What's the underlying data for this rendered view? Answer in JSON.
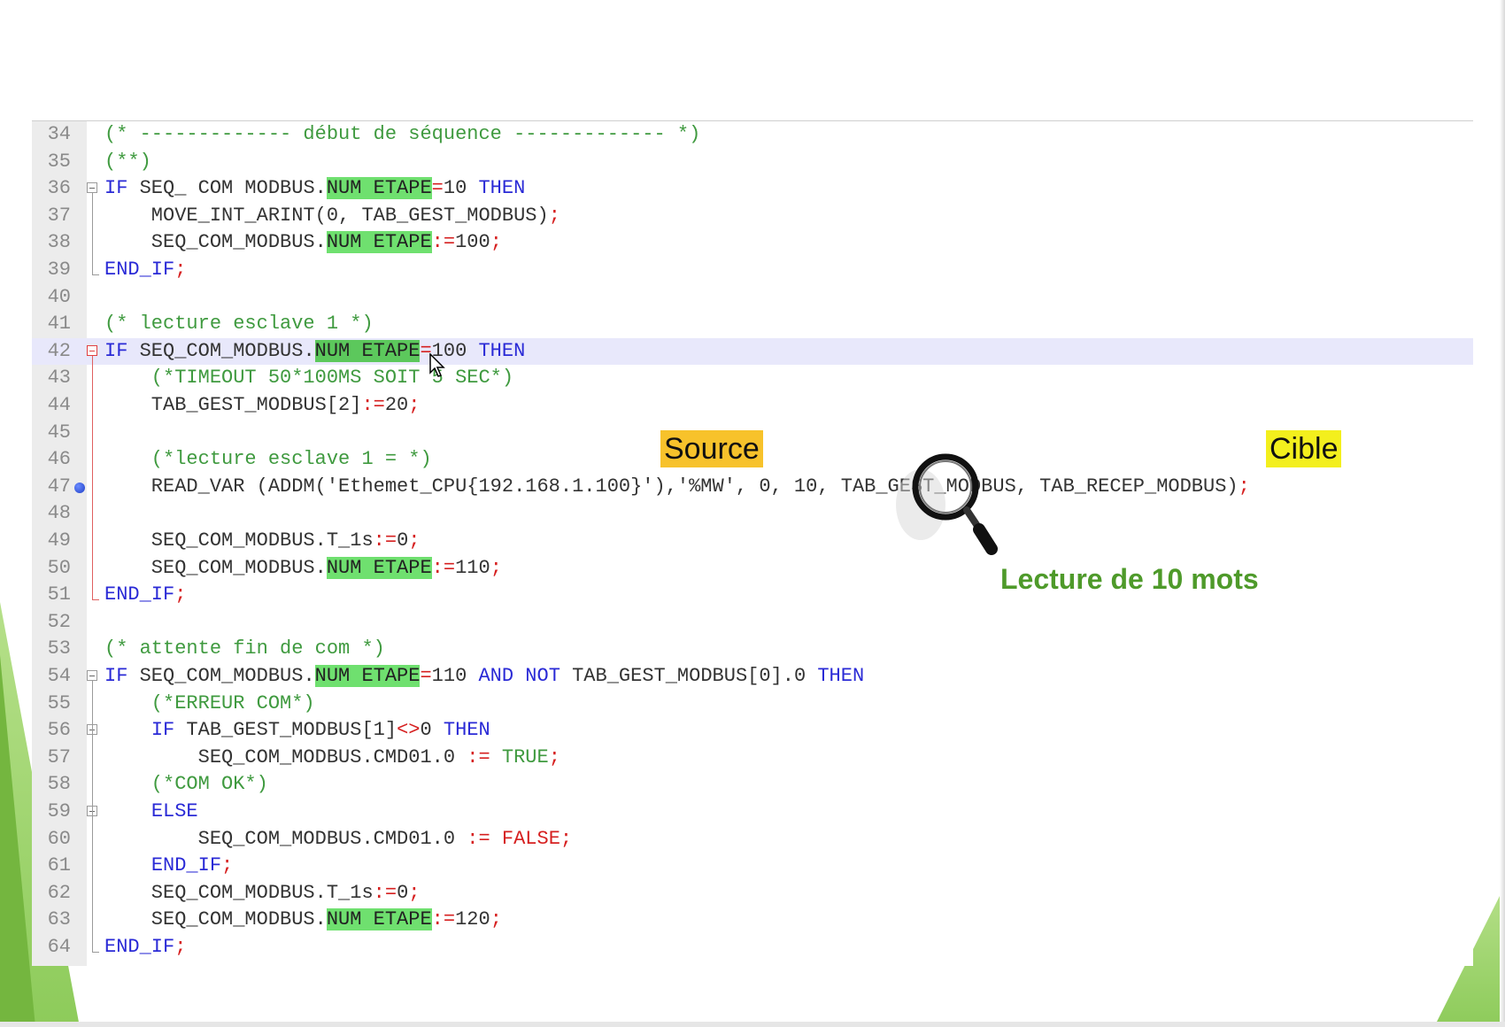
{
  "editor": {
    "lines": [
      {
        "num": "34",
        "segments": [
          {
            "t": "cm",
            "v": "(* ------------- début de séquence ------------- *)"
          }
        ]
      },
      {
        "num": "35",
        "segments": [
          {
            "t": "cm",
            "v": "(**)"
          }
        ]
      },
      {
        "num": "36",
        "fold": "open",
        "segments": [
          {
            "t": "kw",
            "v": "IF"
          },
          {
            "t": "tx",
            "v": " SEQ_ COM MODBUS."
          },
          {
            "t": "hl",
            "v": "NUM ETAPE"
          },
          {
            "t": "op",
            "v": "="
          },
          {
            "t": "tx",
            "v": "10 "
          },
          {
            "t": "kw",
            "v": "THEN"
          }
        ]
      },
      {
        "num": "37",
        "segments": [
          {
            "t": "tx",
            "v": "    MOVE_INT_ARINT(0, TAB_GEST_MODBUS)"
          },
          {
            "t": "op",
            "v": ";"
          }
        ]
      },
      {
        "num": "38",
        "segments": [
          {
            "t": "tx",
            "v": "    SEQ_COM_MODBUS."
          },
          {
            "t": "hl",
            "v": "NUM ETAPE"
          },
          {
            "t": "op",
            "v": ":="
          },
          {
            "t": "tx",
            "v": "100"
          },
          {
            "t": "op",
            "v": ";"
          }
        ]
      },
      {
        "num": "39",
        "fold": "end",
        "segments": [
          {
            "t": "kw",
            "v": "END_IF"
          },
          {
            "t": "op",
            "v": ";"
          }
        ]
      },
      {
        "num": "40",
        "segments": []
      },
      {
        "num": "41",
        "segments": [
          {
            "t": "cm",
            "v": "(* lecture esclave 1 *)"
          }
        ]
      },
      {
        "num": "42",
        "fold": "open-red",
        "current": true,
        "segments": [
          {
            "t": "kw",
            "v": "IF"
          },
          {
            "t": "tx",
            "v": " SEQ_COM_MODBUS."
          },
          {
            "t": "hl2",
            "v": "NUM ETAPE"
          },
          {
            "t": "op",
            "v": "="
          },
          {
            "t": "tx",
            "v": "100 "
          },
          {
            "t": "kw",
            "v": "THEN"
          }
        ]
      },
      {
        "num": "43",
        "segments": [
          {
            "t": "cm",
            "v": "    (*TIMEOUT 50*100MS SOIT 5 SEC*)"
          }
        ]
      },
      {
        "num": "44",
        "segments": [
          {
            "t": "tx",
            "v": "    TAB_GEST_MODBUS[2]"
          },
          {
            "t": "op",
            "v": ":="
          },
          {
            "t": "tx",
            "v": "20"
          },
          {
            "t": "op",
            "v": ";"
          }
        ]
      },
      {
        "num": "45",
        "segments": []
      },
      {
        "num": "46",
        "segments": [
          {
            "t": "cm",
            "v": "    (*lecture esclave 1 = *)"
          }
        ]
      },
      {
        "num": "47",
        "breakpoint": true,
        "segments": [
          {
            "t": "tx",
            "v": "    READ_VAR (ADDM('Ethemet_CPU{192.168.1.100}'),'%MW', 0, 10, TAB_GEST_MODBUS, TAB_RECEP_MODBUS)"
          },
          {
            "t": "op",
            "v": ";"
          }
        ]
      },
      {
        "num": "48",
        "segments": []
      },
      {
        "num": "49",
        "segments": [
          {
            "t": "tx",
            "v": "    SEQ_COM_MODBUS.T_1s"
          },
          {
            "t": "op",
            "v": ":="
          },
          {
            "t": "tx",
            "v": "0"
          },
          {
            "t": "op",
            "v": ";"
          }
        ]
      },
      {
        "num": "50",
        "segments": [
          {
            "t": "tx",
            "v": "    SEQ_COM_MODBUS."
          },
          {
            "t": "hl",
            "v": "NUM ETAPE"
          },
          {
            "t": "op",
            "v": ":="
          },
          {
            "t": "tx",
            "v": "110"
          },
          {
            "t": "op",
            "v": ";"
          }
        ]
      },
      {
        "num": "51",
        "fold": "end-red",
        "segments": [
          {
            "t": "kw",
            "v": "END_IF"
          },
          {
            "t": "op",
            "v": ";"
          }
        ]
      },
      {
        "num": "52",
        "segments": []
      },
      {
        "num": "53",
        "segments": [
          {
            "t": "cm",
            "v": "(* attente fin de com *)"
          }
        ]
      },
      {
        "num": "54",
        "fold": "open",
        "segments": [
          {
            "t": "kw",
            "v": "IF"
          },
          {
            "t": "tx",
            "v": " SEQ_COM_MODBUS."
          },
          {
            "t": "hl",
            "v": "NUM ETAPE"
          },
          {
            "t": "op",
            "v": "="
          },
          {
            "t": "tx",
            "v": "110 "
          },
          {
            "t": "kw",
            "v": "AND NOT"
          },
          {
            "t": "tx",
            "v": " TAB_GEST_MODBUS[0].0 "
          },
          {
            "t": "kw",
            "v": "THEN"
          }
        ]
      },
      {
        "num": "55",
        "segments": [
          {
            "t": "cm",
            "v": "    (*ERREUR COM*)"
          }
        ]
      },
      {
        "num": "56",
        "fold": "open",
        "segments": [
          {
            "t": "tx",
            "v": "    "
          },
          {
            "t": "kw",
            "v": "IF"
          },
          {
            "t": "tx",
            "v": " TAB_GEST_MODBUS[1]"
          },
          {
            "t": "op",
            "v": "<>"
          },
          {
            "t": "tx",
            "v": "0 "
          },
          {
            "t": "kw",
            "v": "THEN"
          }
        ]
      },
      {
        "num": "57",
        "segments": [
          {
            "t": "tx",
            "v": "        SEQ_COM_MODBUS.CMD01.0 "
          },
          {
            "t": "op",
            "v": ":="
          },
          {
            "t": "tx",
            "v": " "
          },
          {
            "t": "cm",
            "v": "TRUE"
          },
          {
            "t": "op",
            "v": ";"
          }
        ]
      },
      {
        "num": "58",
        "segments": [
          {
            "t": "cm",
            "v": "    (*COM OK*)"
          }
        ]
      },
      {
        "num": "59",
        "fold": "open",
        "segments": [
          {
            "t": "tx",
            "v": "    "
          },
          {
            "t": "kw",
            "v": "ELSE"
          }
        ]
      },
      {
        "num": "60",
        "segments": [
          {
            "t": "tx",
            "v": "        SEQ_COM_MODBUS.CMD01.0 "
          },
          {
            "t": "op",
            "v": ":="
          },
          {
            "t": "tx",
            "v": " "
          },
          {
            "t": "op",
            "v": "FALSE;"
          }
        ]
      },
      {
        "num": "61",
        "segments": [
          {
            "t": "tx",
            "v": "    "
          },
          {
            "t": "kw",
            "v": "END_IF"
          },
          {
            "t": "op",
            "v": ";"
          }
        ]
      },
      {
        "num": "62",
        "segments": [
          {
            "t": "tx",
            "v": "    SEQ_COM_MODBUS.T_1s"
          },
          {
            "t": "op",
            "v": ":="
          },
          {
            "t": "tx",
            "v": "0"
          },
          {
            "t": "op",
            "v": ";"
          }
        ]
      },
      {
        "num": "63",
        "segments": [
          {
            "t": "tx",
            "v": "    SEQ_COM_MODBUS."
          },
          {
            "t": "hl",
            "v": "NUM ETAPE"
          },
          {
            "t": "op",
            "v": ":="
          },
          {
            "t": "tx",
            "v": "120"
          },
          {
            "t": "op",
            "v": ";"
          }
        ]
      },
      {
        "num": "64",
        "fold": "end",
        "segments": [
          {
            "t": "kw",
            "v": "END_IF"
          },
          {
            "t": "op",
            "v": ";"
          }
        ]
      }
    ]
  },
  "annotations": {
    "source_label": "Source",
    "cible_label": "Cible",
    "lecture_caption": "Lecture de 10 mots"
  },
  "colors": {
    "source_bg": "#f7c22b",
    "cible_bg": "#f3ef1d",
    "caption": "#4e9a2a",
    "highlight": "#6fe06f",
    "keyword": "#2a2ad6",
    "comment": "#3f9a3f",
    "operator": "#d62020"
  },
  "icons": {
    "magnifier": "magnifier-icon",
    "cursor": "mouse-cursor-icon",
    "breakpoint": "breakpoint-icon",
    "fold": "fold-toggle-icon"
  }
}
